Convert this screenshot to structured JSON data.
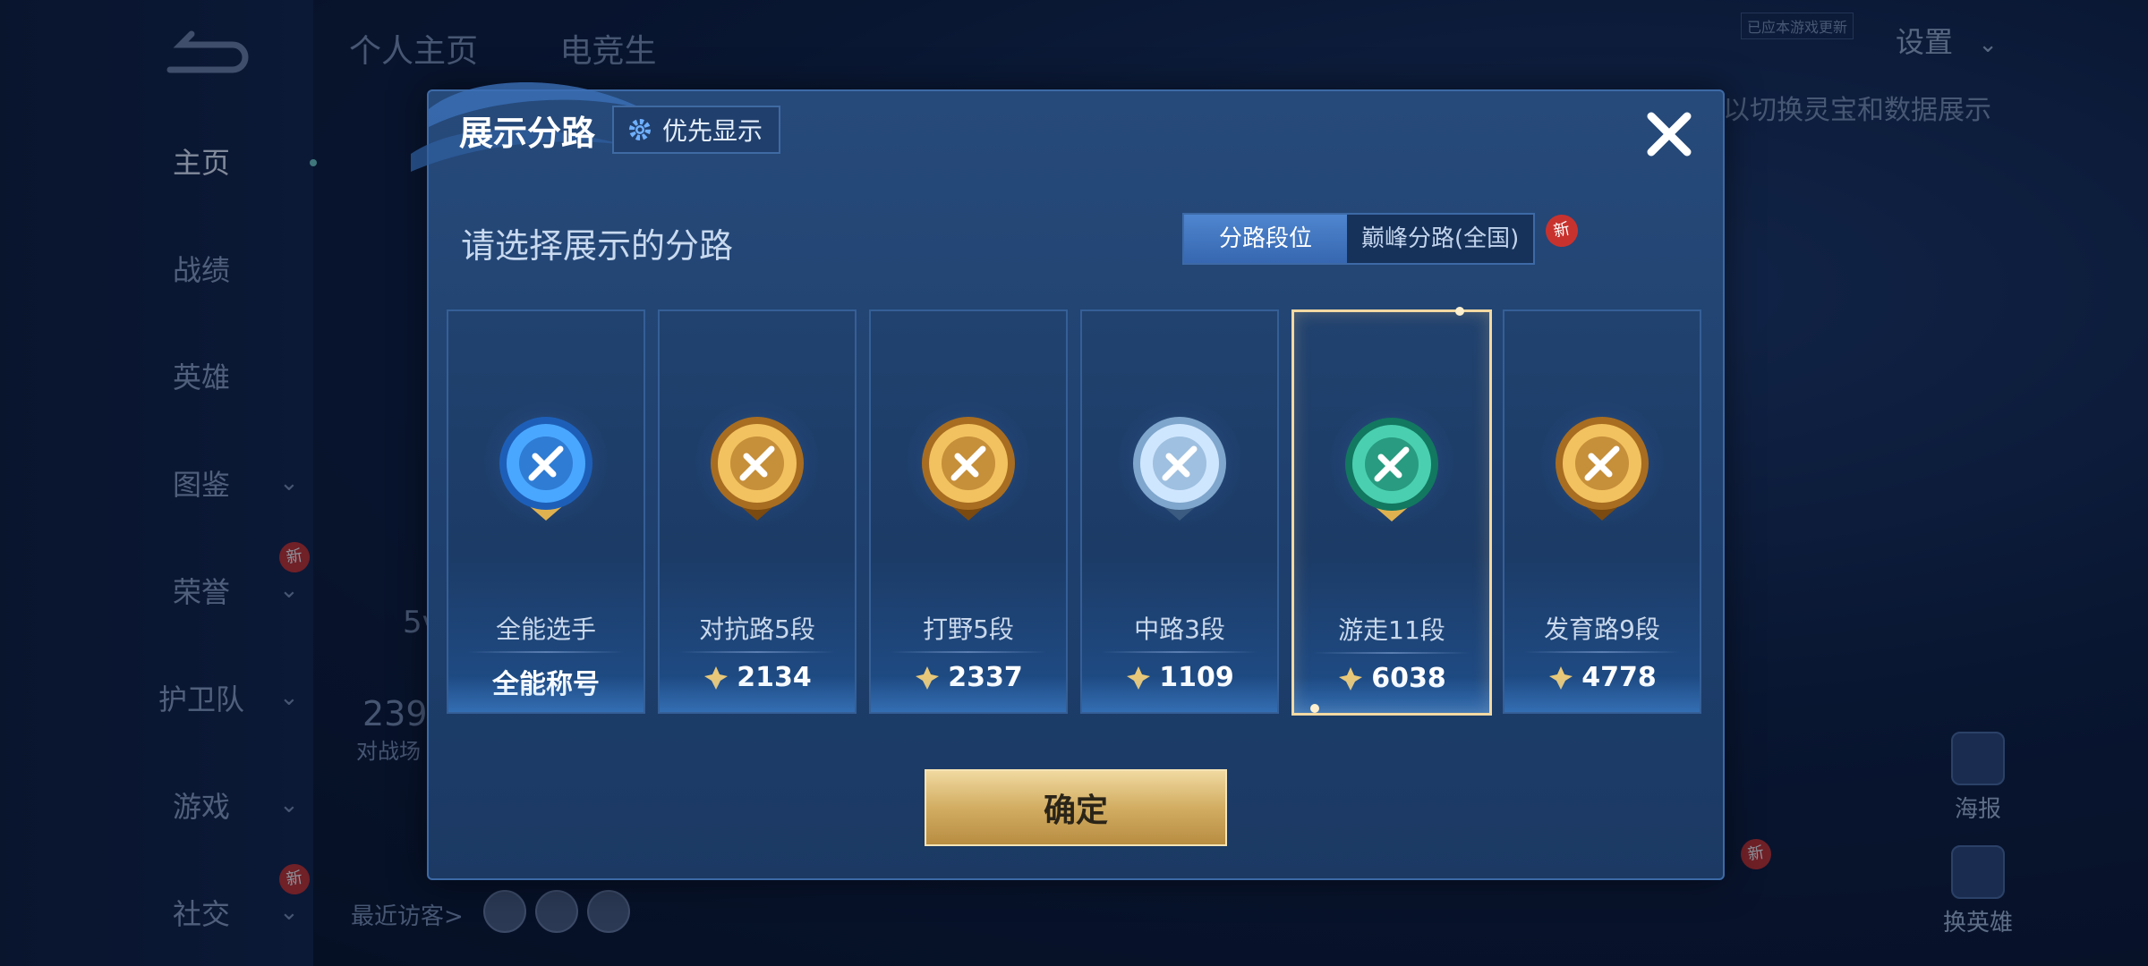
{
  "sidebar": {
    "items": [
      {
        "label": "主页",
        "has_chevron": false,
        "is_new": false
      },
      {
        "label": "战绩",
        "has_chevron": false,
        "is_new": false
      },
      {
        "label": "英雄",
        "has_chevron": false,
        "is_new": false
      },
      {
        "label": "图鉴",
        "has_chevron": true,
        "is_new": false
      },
      {
        "label": "荣誉",
        "has_chevron": true,
        "is_new": true
      },
      {
        "label": "护卫队",
        "has_chevron": true,
        "is_new": false
      },
      {
        "label": "游戏",
        "has_chevron": true,
        "is_new": false
      },
      {
        "label": "社交",
        "has_chevron": true,
        "is_new": true
      }
    ],
    "new_badge": "新",
    "chevron": "⌄"
  },
  "background": {
    "tabs": [
      "个人主页",
      "电竞生"
    ],
    "settings_label": "设置",
    "notice_tag": "已应本游戏更新",
    "hint": "以切换灵宝和数据展示",
    "left_fragments": [
      "5v",
      "239",
      "对战场"
    ],
    "recent_visitors": "最近访客>",
    "right_buttons": [
      {
        "label": "海报"
      },
      {
        "label": "换英雄"
      }
    ],
    "right_new_badge": "新"
  },
  "dialog": {
    "title": "展示分路",
    "priority_button": "优先显示",
    "subtitle": "请选择展示的分路",
    "segment": {
      "options": [
        "分路段位",
        "巅峰分路(全国)"
      ],
      "selected_index": 0,
      "new_badge": "新"
    },
    "cards": [
      {
        "name": "全能选手",
        "score": "全能称号",
        "has_power_icon": false,
        "emblem": "all-round-emblem",
        "selected": false
      },
      {
        "name": "对抗路5段",
        "score": "2134",
        "has_power_icon": true,
        "emblem": "clash-lane-emblem",
        "selected": false
      },
      {
        "name": "打野5段",
        "score": "2337",
        "has_power_icon": true,
        "emblem": "jungle-emblem",
        "selected": false
      },
      {
        "name": "中路3段",
        "score": "1109",
        "has_power_icon": true,
        "emblem": "mid-lane-emblem",
        "selected": false
      },
      {
        "name": "游走11段",
        "score": "6038",
        "has_power_icon": true,
        "emblem": "roam-emblem",
        "selected": true
      },
      {
        "name": "发育路9段",
        "score": "4778",
        "has_power_icon": true,
        "emblem": "farm-lane-emblem",
        "selected": false
      }
    ],
    "confirm_button": "确定"
  },
  "colors": {
    "accent_gold": "#d2ad62",
    "selected_border": "#f3d9a2",
    "badge_red": "#c8322e",
    "panel_blue": "#264a7a"
  }
}
